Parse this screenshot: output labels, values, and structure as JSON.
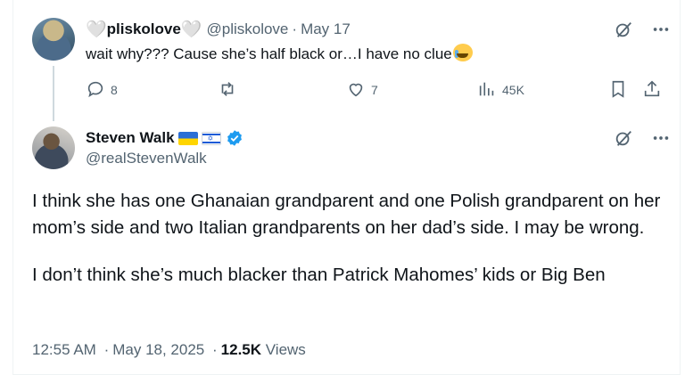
{
  "reply": {
    "display_name": "pliskolove",
    "heart_left": "🤍",
    "heart_right": "🤍",
    "handle": "@pliskolove",
    "separator": "·",
    "date": "May 17",
    "text": "wait why??? Cause she’s half black or…I have no clue",
    "emoji": "loudly-crying-face",
    "replies": "8",
    "likes": "7",
    "views": "45K"
  },
  "main_post": {
    "display_name": "Steven Walk",
    "flags": [
      "ukraine-flag",
      "israel-flag"
    ],
    "verified": true,
    "handle": "@realStevenWalk",
    "paragraph_1": "I think she has one Ghanaian grandparent and one Polish grandparent on her mom’s side and two Italian grandparents on her dad’s side. I may be wrong.",
    "paragraph_2": "I don’t think she’s much blacker than Patrick Mahomes’ kids or Big Ben",
    "time": "12:55 AM",
    "date": "May 18, 2025",
    "separator": "·",
    "views_count": "12.5K",
    "views_label": "Views"
  },
  "colors": {
    "text": "#0f1419",
    "secondary": "#536471",
    "verified": "#1d9bf0",
    "border": "#eff3f4"
  }
}
